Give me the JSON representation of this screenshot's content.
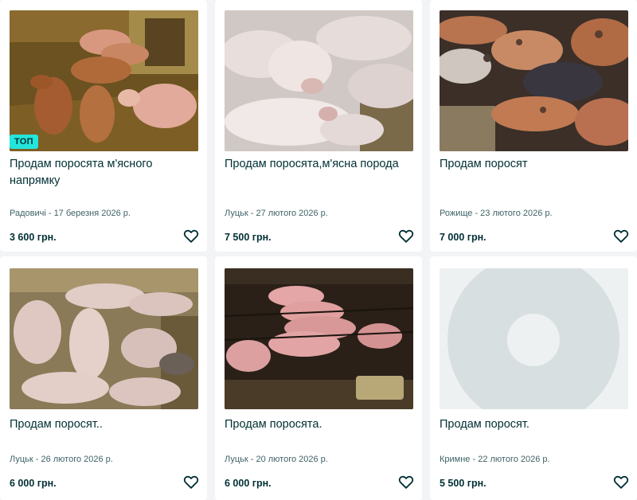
{
  "badge_label": "ТОП",
  "listings": [
    {
      "title": "Продам поросята м'ясного напрямку",
      "meta": "Радовичі - 17 березня 2026 р.",
      "price": "3 600 грн.",
      "image": "piglets-brown-on-straw",
      "top": true
    },
    {
      "title": "Продам поросята,м'ясна порода",
      "meta": "Луцьк - 27 лютого 2026 р.",
      "price": "7 500 грн.",
      "image": "pink-piglets-closeup",
      "top": false
    },
    {
      "title": "Продам поросят",
      "meta": "Рожище - 23 лютого 2026 р.",
      "price": "7 000 грн.",
      "image": "spotted-piglets-pile",
      "top": false
    },
    {
      "title": "Продам поросят..",
      "meta": "Луцьк - 26 лютого 2026 р.",
      "price": "6 000 грн.",
      "image": "piglets-group-on-straw",
      "top": false
    },
    {
      "title": "Продам поросята.",
      "meta": "Луцьк - 20 лютого 2026 р.",
      "price": "6 000 грн.",
      "image": "piglets-in-pen-dark",
      "top": false
    },
    {
      "title": "Продам поросят.",
      "meta": "Кримне - 22 лютого 2026 р.",
      "price": "5 500 грн.",
      "image": "image-placeholder",
      "top": false
    }
  ],
  "colors": {
    "page_bg": "#f2f4f5",
    "card_bg": "#ffffff",
    "text": "#002f34",
    "meta_text": "#406367",
    "badge_bg": "#23e5db"
  },
  "icons": {
    "favorite": "heart-outline-icon"
  }
}
